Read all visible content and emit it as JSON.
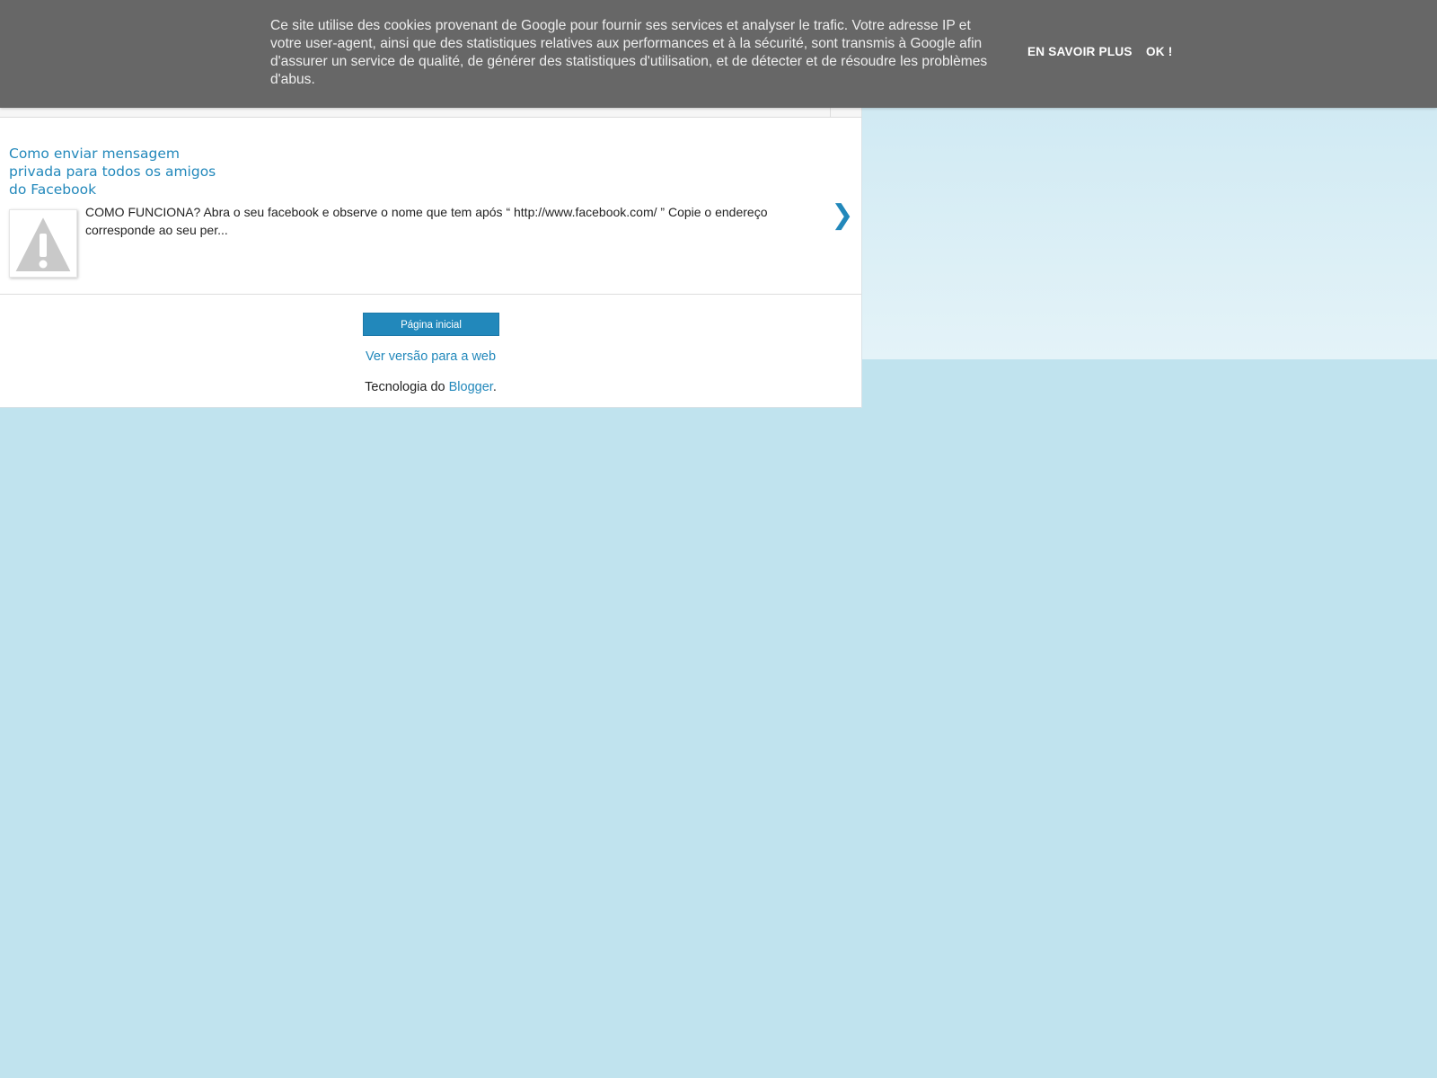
{
  "cookie_banner": {
    "text": "Ce site utilise des cookies provenant de Google pour fournir ses services et analyser le trafic. Votre adresse IP et votre user-agent, ainsi que des statistiques relatives aux performances et à la sécurité, sont transmis à Google afin d'assurer un service de qualité, de générer des statistiques d'utilisation, et de détecter et de résoudre les problèmes d'abus.",
    "learn_more_label": "EN SAVOIR PLUS",
    "ok_label": "OK !"
  },
  "post": {
    "title": "Como enviar mensagem privada para todos os amigos do Facebook",
    "snippet": "COMO FUNCIONA? Abra o seu facebook e observe o nome que tem após “ http://www.facebook.com/ ” Copie o endereço corresponde ao seu per...",
    "thumbnail_icon": "warning-placeholder-icon",
    "next_icon": "›",
    "next_glyph": "❯"
  },
  "footer": {
    "home_button_label": "Página inicial",
    "web_version_label": "Ver versão para a web",
    "powered_prefix": "Tecnologia do ",
    "powered_link": "Blogger",
    "powered_suffix": "."
  },
  "colors": {
    "link": "#2288bb",
    "banner_bg": "#676767",
    "page_bg": "#c0e3ee"
  }
}
